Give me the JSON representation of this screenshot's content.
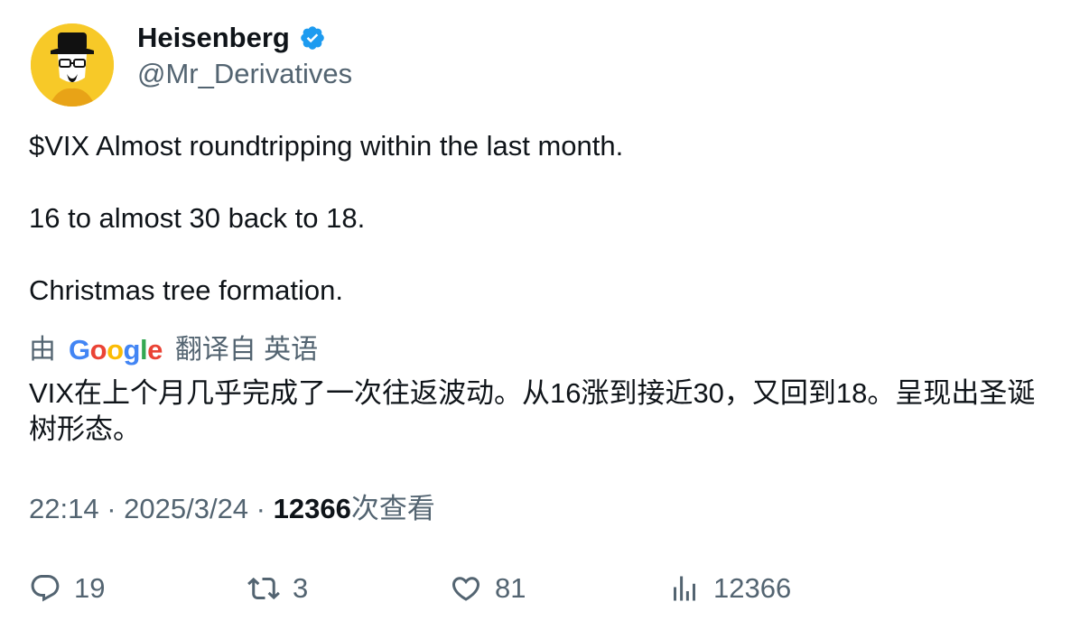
{
  "author": {
    "display_name": "Heisenberg",
    "handle": "@Mr_Derivatives",
    "verified": true,
    "verified_color": "#1d9bf0",
    "avatar_bg": "#f7c928"
  },
  "tweet": {
    "text": "$VIX Almost roundtripping within the last month.\n\n16 to almost 30 back to 18.\n\nChristmas tree formation."
  },
  "translation": {
    "prefix": "由",
    "provider": "Google",
    "suffix": "翻译自 英语",
    "text": "VIX在上个月几乎完成了一次往返波动。从16涨到接近30，又回到18。呈现出圣诞树形态。"
  },
  "meta": {
    "time": "22:14",
    "separator1": " · ",
    "date": "2025/3/24",
    "separator2": " · ",
    "views_count": "12366",
    "views_label": "次查看"
  },
  "actions": {
    "replies": "19",
    "retweets": "3",
    "likes": "81",
    "views": "12366"
  },
  "colors": {
    "text": "#0f1419",
    "secondary": "#536471"
  }
}
